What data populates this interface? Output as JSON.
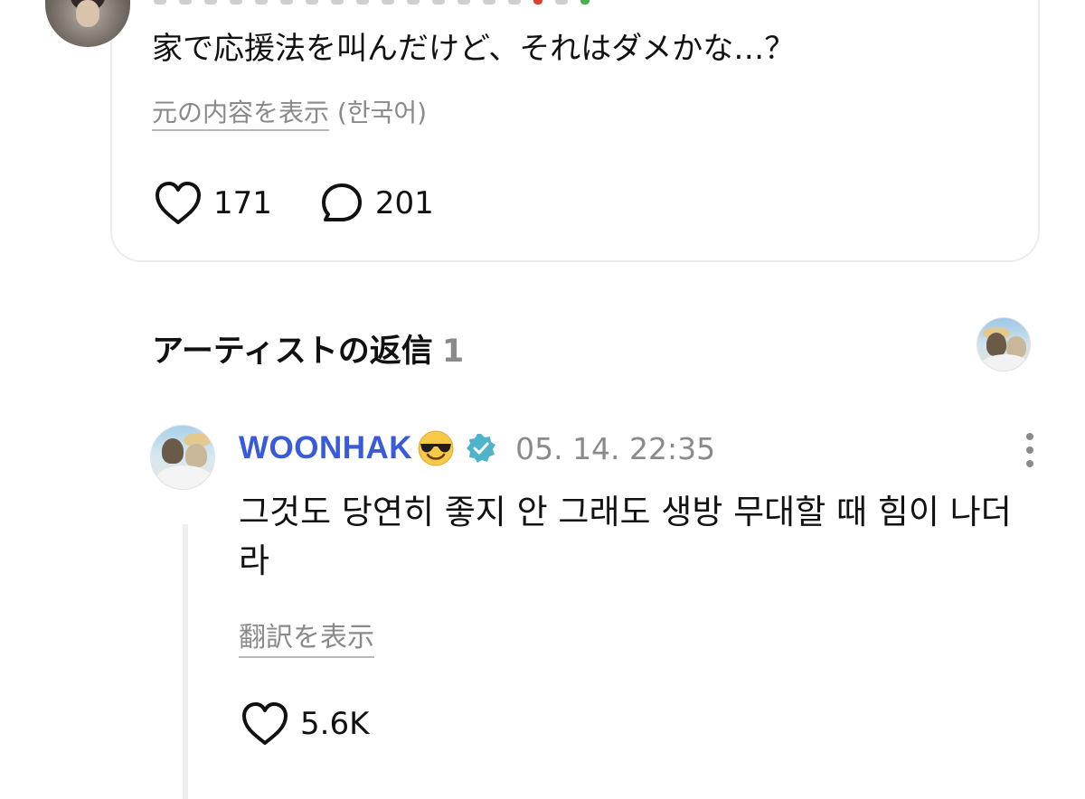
{
  "post": {
    "text": "家で応援法を叫んだけど、それはダメかな…？",
    "show_original_label": "元の内容を表示",
    "original_language": "(한국어)",
    "likes": "171",
    "comments": "201"
  },
  "artist_replies": {
    "title": "アーティストの返信",
    "count": "1"
  },
  "reply": {
    "author": "WOONHAK",
    "author_emoji": "smiling-face-with-sunglasses-icon",
    "verified_icon": "verified-badge-icon",
    "timestamp": "05. 14. 22:35",
    "text": "그것도 당연히 좋지 안 그래도 생방 무대할 때 힘이 나더라",
    "show_translation_label": "翻訳を表示",
    "likes": "5.6K"
  },
  "colors": {
    "author_link": "#3a5bd9",
    "verified": "#4fb3c9",
    "muted_text": "#8a8a8a",
    "card_border": "#ececec"
  },
  "icons": [
    "heart-outline-icon",
    "comment-bubble-icon",
    "more-vertical-icon",
    "verified-badge-icon",
    "smiling-face-with-sunglasses-icon"
  ]
}
